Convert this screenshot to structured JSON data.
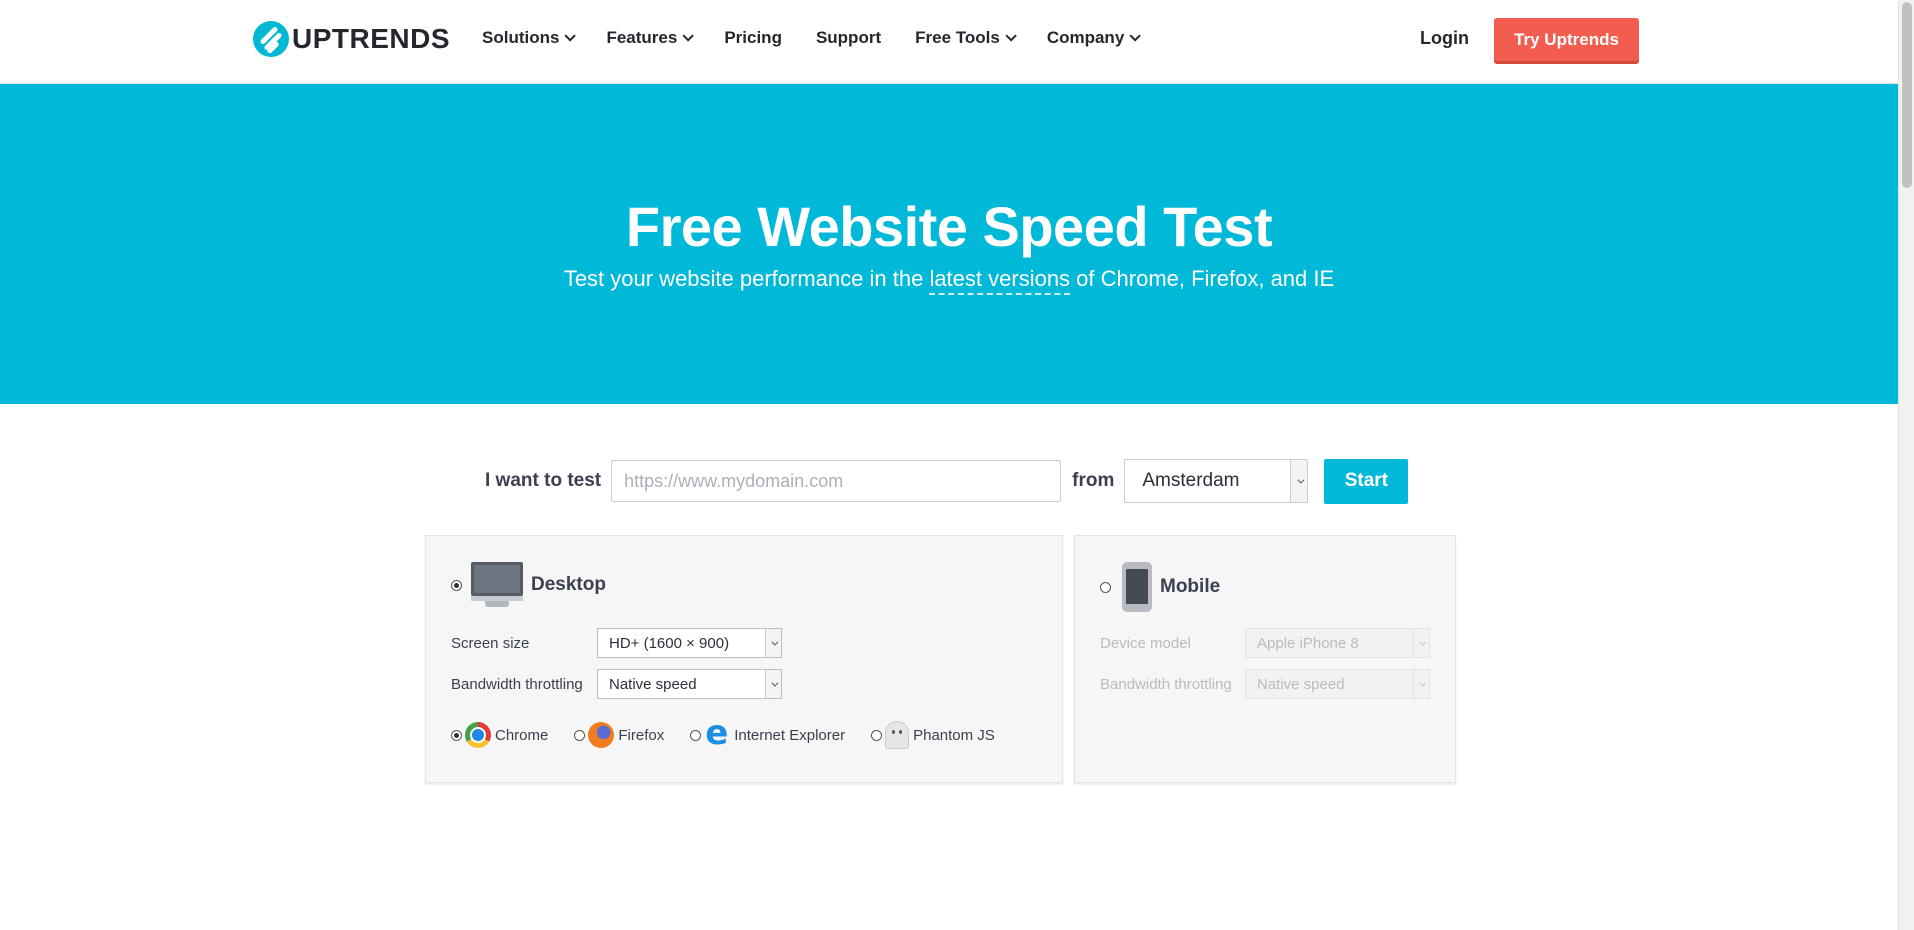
{
  "header": {
    "logo_text": "UPTRENDS",
    "nav": [
      {
        "label": "Solutions",
        "dropdown": true
      },
      {
        "label": "Features",
        "dropdown": true
      },
      {
        "label": "Pricing",
        "dropdown": false
      },
      {
        "label": "Support",
        "dropdown": false
      },
      {
        "label": "Free Tools",
        "dropdown": true
      },
      {
        "label": "Company",
        "dropdown": true
      }
    ],
    "login": "Login",
    "cta": "Try Uptrends"
  },
  "hero": {
    "title": "Free Website Speed Test",
    "subtitle_before": "Test your website performance in the ",
    "subtitle_link": "latest versions",
    "subtitle_after": " of Chrome, Firefox, and IE"
  },
  "test_form": {
    "label": "I want to test",
    "url_placeholder": "https://www.mydomain.com",
    "url_value": "",
    "from_label": "from",
    "location": "Amsterdam",
    "start": "Start"
  },
  "desktop": {
    "title": "Desktop",
    "selected": true,
    "screen_size_label": "Screen size",
    "screen_size": "HD+ (1600 × 900)",
    "bandwidth_label": "Bandwidth throttling",
    "bandwidth": "Native speed",
    "browsers": [
      {
        "label": "Chrome",
        "icon": "chrome-icon",
        "selected": true
      },
      {
        "label": "Firefox",
        "icon": "firefox-icon",
        "selected": false
      },
      {
        "label": "Internet Explorer",
        "icon": "ie-icon",
        "selected": false
      },
      {
        "label": "Phantom JS",
        "icon": "ghost-icon",
        "selected": false
      }
    ]
  },
  "mobile": {
    "title": "Mobile",
    "selected": false,
    "device_label": "Device model",
    "device": "Apple iPhone 8",
    "bandwidth_label": "Bandwidth throttling",
    "bandwidth": "Native speed"
  },
  "colors": {
    "brand": "#00b8d7",
    "cta": "#f35d4f"
  }
}
